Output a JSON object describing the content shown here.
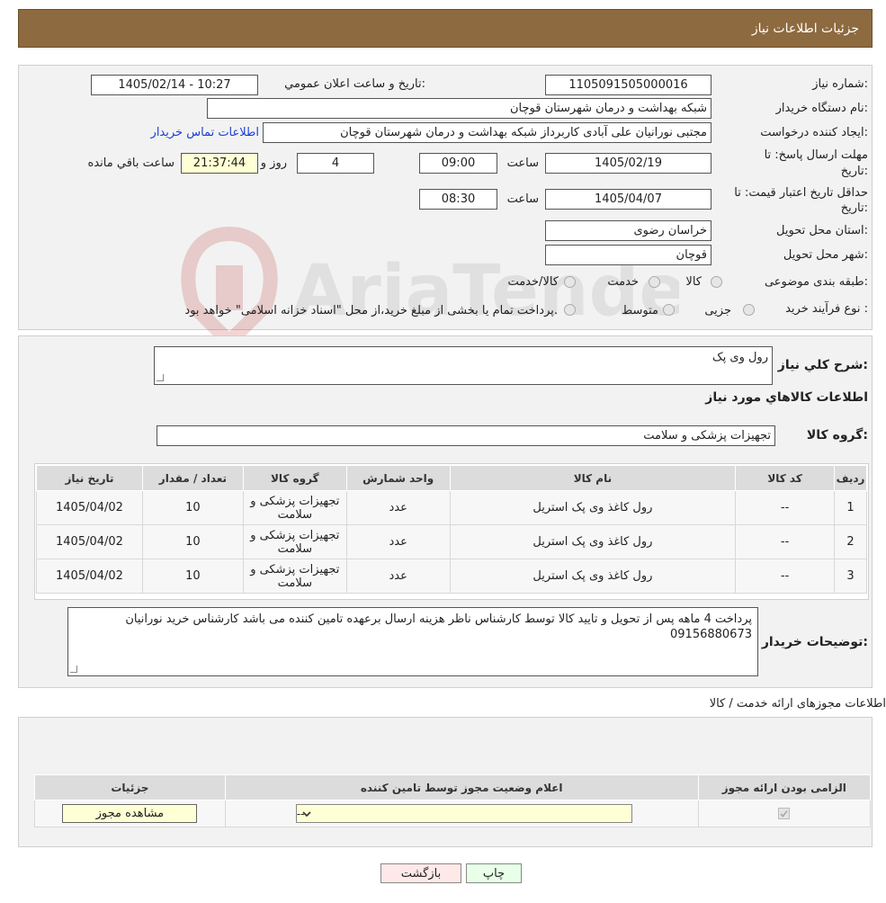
{
  "header": {
    "title": "جزئیات اطلاعات نیاز"
  },
  "watermark": {
    "text": "AriaTender.neT"
  },
  "form": {
    "need_number_label": "شماره نیاز:",
    "need_number": "1105091505000016",
    "announce_label": "تاریخ و ساعت اعلان عمومي:",
    "announce_value": "1405/02/14 - 10:27",
    "buyer_label": "نام دستگاه خریدار:",
    "buyer_value": "شبکه بهداشت و درمان شهرستان قوچان",
    "requester_label": "ایجاد کننده درخواست:",
    "requester_value": "مجتبی نورانیان علی آبادی کاربرداز شبکه بهداشت و درمان شهرستان قوچان",
    "contact_link": "اطلاعات تماس خریدار",
    "deadline_label_1": "مهلت ارسال پاسخ: تا",
    "deadline_label_2": "تاریخ:",
    "deadline_date": "1405/02/19",
    "time_label": "ساعت",
    "deadline_time": "09:00",
    "days_value": "4",
    "days_label": "روز و",
    "remaining_time": "21:37:44",
    "remaining_label": "ساعت باقي مانده",
    "validity_label_1": "حداقل تاریخ اعتبار قیمت: تا",
    "validity_label_2": "تاریخ:",
    "validity_date": "1405/04/07",
    "validity_time": "08:30",
    "province_label": "استان محل تحویل:",
    "province_value": "خراسان رضوی",
    "city_label": "شهر محل تحویل:",
    "city_value": "قوچان",
    "category_label": "طبقه بندی موضوعی:",
    "category_options": [
      "کالا",
      "خدمت",
      "کالا/خدمت"
    ],
    "process_label": "نوع فرآیند خرید :",
    "process_options": [
      "جزیی",
      "متوسط"
    ],
    "process_note": "پرداخت تمام یا بخشی از مبلغ خرید،از محل \"اسناد خزانه اسلامی\" خواهد بود."
  },
  "goods": {
    "description_label": "شرح کلي نیاز:",
    "description_value": "رول وی پک",
    "section_title": "اطلاعات کالاهاي مورد نیاز",
    "group_label": "گروه کالا:",
    "group_value": "تجهیزات پزشکی و سلامت",
    "columns": [
      "ردیف",
      "کد کالا",
      "نام کالا",
      "واحد شمارش",
      "گروه کالا",
      "تعداد / مقدار",
      "تاریخ نیاز"
    ],
    "rows": [
      {
        "idx": "1",
        "code": "--",
        "name": "رول کاغذ وی پک استریل",
        "unit": "عدد",
        "group": "تجهیزات پزشکی و سلامت",
        "qty": "10",
        "date": "1405/04/02"
      },
      {
        "idx": "2",
        "code": "--",
        "name": "رول کاغذ وی پک استریل",
        "unit": "عدد",
        "group": "تجهیزات پزشکی و سلامت",
        "qty": "10",
        "date": "1405/04/02"
      },
      {
        "idx": "3",
        "code": "--",
        "name": "رول کاغذ وی پک استریل",
        "unit": "عدد",
        "group": "تجهیزات پزشکی و سلامت",
        "qty": "10",
        "date": "1405/04/02"
      }
    ],
    "buyer_notes_label": "توضیحات خریدار:",
    "buyer_notes": "پرداخت 4 ماهه پس از تحویل و تایید کالا توسط کارشناس ناظر هزینه ارسال برعهده تامین کننده می باشد کارشناس خرید نورانیان 09156880673"
  },
  "permits": {
    "title": "اطلاعات مجوزهای ارائه خدمت / کالا",
    "col_required": "الزامی بودن ارائه مجوز",
    "col_status": "اعلام وضعیت مجوز توسط تامین کننده",
    "col_details": "جزئیات",
    "select_value": "--",
    "view_button": "مشاهده مجوز"
  },
  "actions": {
    "print": "چاپ",
    "back": "بازگشت"
  }
}
